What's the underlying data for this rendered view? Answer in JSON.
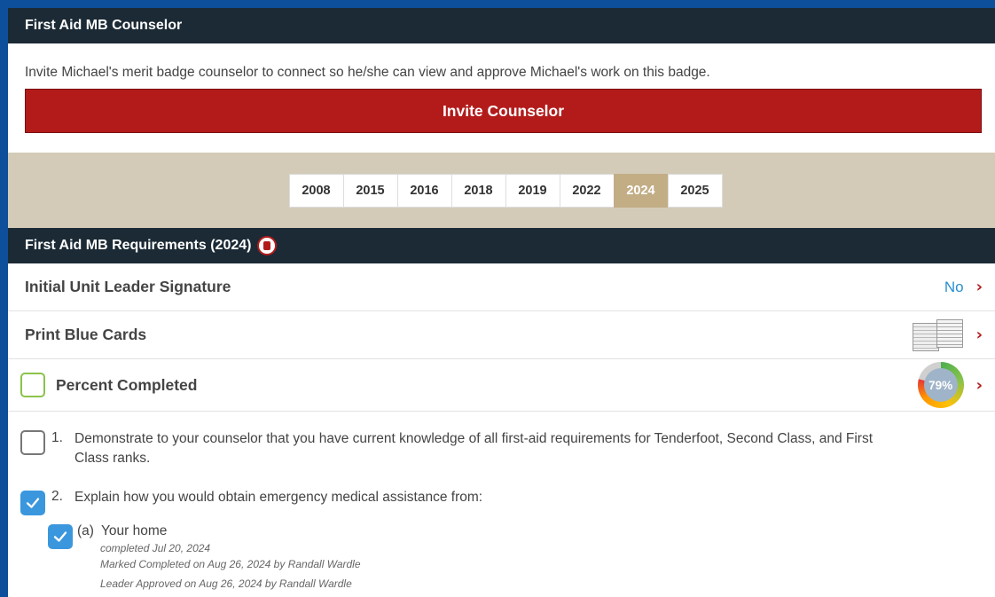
{
  "counselor": {
    "title": "First Aid MB Counselor",
    "invite_text": "Invite Michael's merit badge counselor to connect so he/she can view and approve Michael's work on this badge.",
    "invite_button": "Invite Counselor"
  },
  "years": {
    "items": [
      "2008",
      "2015",
      "2016",
      "2018",
      "2019",
      "2022",
      "2024",
      "2025"
    ],
    "selected": "2024"
  },
  "requirements_header": {
    "title": "First Aid MB Requirements (2024)"
  },
  "rows": {
    "leader_signature": {
      "label": "Initial Unit Leader Signature",
      "value": "No"
    },
    "blue_cards": {
      "label": "Print Blue Cards"
    },
    "percent": {
      "label": "Percent Completed",
      "value": "79%",
      "fraction": 0.79
    }
  },
  "requirements": [
    {
      "num": "1.",
      "text_line1": "Demonstrate to your counselor that you have current knowledge of all first-aid requirements for Tenderfoot, Second Class, and First",
      "text_line2": "Class ranks.",
      "checked": false
    },
    {
      "num": "2.",
      "text": "Explain how you would obtain emergency medical assistance from:",
      "checked": true
    }
  ],
  "sub_requirements": [
    {
      "letter": "(a)",
      "text": "Your home",
      "completed": "completed Jul 20, 2024",
      "marked": "Marked Completed on Aug 26, 2024 by Randall Wardle",
      "approved": "Leader Approved on Aug 26, 2024 by Randall Wardle",
      "checked": true
    }
  ],
  "colors": {
    "header_bg": "#1b2a35",
    "invite_red": "#b31b1b",
    "band_tan": "#d3cbb8",
    "year_active": "#c2ad85",
    "check_blue": "#3b97dd",
    "link_blue": "#2a8fd1"
  }
}
